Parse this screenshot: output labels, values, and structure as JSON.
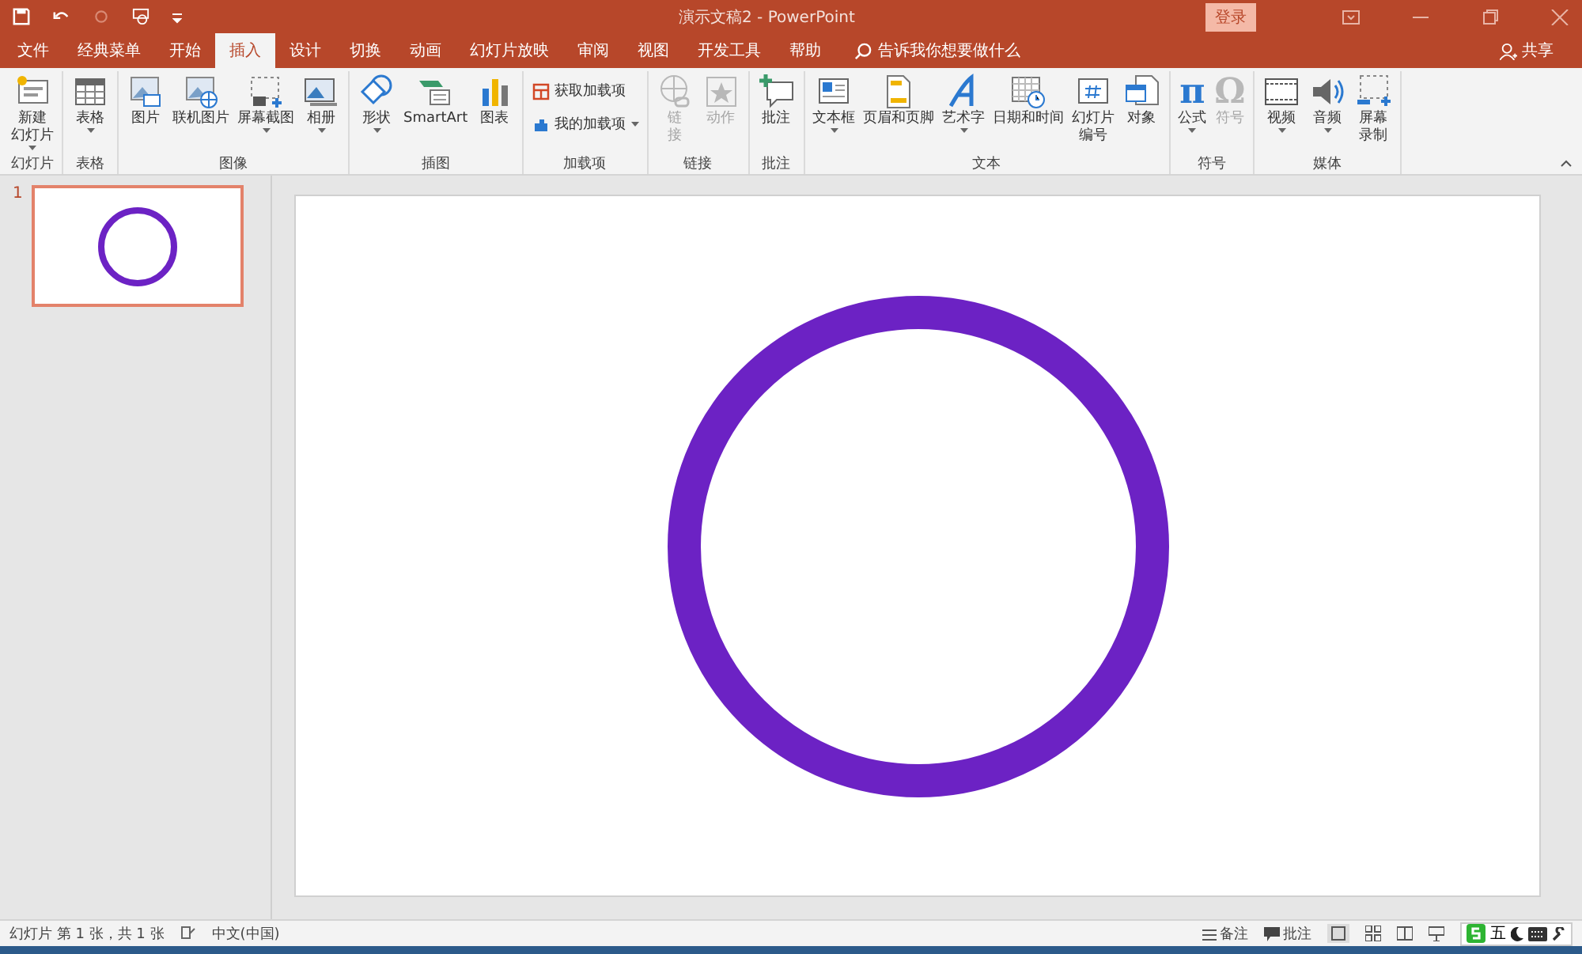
{
  "window": {
    "title": "演示文稿2  -  PowerPoint",
    "login": "登录"
  },
  "tabs": [
    {
      "label": "文件",
      "selected": false
    },
    {
      "label": "经典菜单",
      "selected": false
    },
    {
      "label": "开始",
      "selected": false
    },
    {
      "label": "插入",
      "selected": true
    },
    {
      "label": "设计",
      "selected": false
    },
    {
      "label": "切换",
      "selected": false
    },
    {
      "label": "动画",
      "selected": false
    },
    {
      "label": "幻灯片放映",
      "selected": false
    },
    {
      "label": "审阅",
      "selected": false
    },
    {
      "label": "视图",
      "selected": false
    },
    {
      "label": "开发工具",
      "selected": false
    },
    {
      "label": "帮助",
      "selected": false
    }
  ],
  "search": {
    "placeholder": "告诉我你想要做什么"
  },
  "share": "共享",
  "ribbon_groups": [
    {
      "label": "幻灯片",
      "kind": "large",
      "buttons": [
        {
          "kind": "slide",
          "label": [
            "新建",
            "幻灯片"
          ],
          "caret": true,
          "disabled": false
        }
      ]
    },
    {
      "label": "表格",
      "kind": "large",
      "buttons": [
        {
          "kind": "table",
          "label": [
            "表格"
          ],
          "caret": true,
          "disabled": false
        }
      ]
    },
    {
      "label": "图像",
      "kind": "large",
      "buttons": [
        {
          "kind": "picture",
          "label": [
            "图片"
          ],
          "caret": false,
          "disabled": false
        },
        {
          "kind": "online",
          "label": [
            "联机图片"
          ],
          "caret": false,
          "disabled": false
        },
        {
          "kind": "screenshot",
          "label": [
            "屏幕截图"
          ],
          "caret": true,
          "disabled": false
        },
        {
          "kind": "album",
          "label": [
            "相册"
          ],
          "caret": true,
          "disabled": false
        }
      ]
    },
    {
      "label": "插图",
      "kind": "large",
      "buttons": [
        {
          "kind": "shapes",
          "label": [
            "形状"
          ],
          "caret": true,
          "disabled": false
        },
        {
          "kind": "smartart",
          "label": [
            "SmartArt"
          ],
          "caret": false,
          "disabled": false
        },
        {
          "kind": "chart",
          "label": [
            "图表"
          ],
          "caret": false,
          "disabled": false
        }
      ]
    },
    {
      "label": "加载项",
      "kind": "small",
      "buttons": [
        {
          "kind": "store",
          "label": [
            "获取加载项"
          ],
          "caret": false,
          "disabled": false
        },
        {
          "kind": "addin",
          "label": [
            "我的加载项"
          ],
          "caret": true,
          "disabled": false
        }
      ]
    },
    {
      "label": "链接",
      "kind": "large",
      "buttons": [
        {
          "kind": "link",
          "label": [
            "链",
            "接"
          ],
          "caret": false,
          "disabled": true
        },
        {
          "kind": "action",
          "label": [
            "动作"
          ],
          "caret": false,
          "disabled": true
        }
      ]
    },
    {
      "label": "批注",
      "kind": "large",
      "buttons": [
        {
          "kind": "comment",
          "label": [
            "批注"
          ],
          "caret": false,
          "disabled": false
        }
      ]
    },
    {
      "label": "文本",
      "kind": "large",
      "buttons": [
        {
          "kind": "textbox",
          "label": [
            "文本框"
          ],
          "caret": true,
          "disabled": false
        },
        {
          "kind": "header",
          "label": [
            "页眉和页脚"
          ],
          "caret": false,
          "disabled": false
        },
        {
          "kind": "wordart",
          "label": [
            "艺术字"
          ],
          "caret": true,
          "disabled": false
        },
        {
          "kind": "datetime",
          "label": [
            "日期和时间"
          ],
          "caret": false,
          "disabled": false
        },
        {
          "kind": "slidenumber",
          "label": [
            "幻灯片",
            "编号"
          ],
          "caret": false,
          "disabled": false
        },
        {
          "kind": "object",
          "label": [
            "对象"
          ],
          "caret": false,
          "disabled": false
        }
      ]
    },
    {
      "label": "符号",
      "kind": "large",
      "buttons": [
        {
          "kind": "glyph",
          "glyph": "π",
          "label": [
            "公式"
          ],
          "caret": true,
          "disabled": false
        },
        {
          "kind": "glyph",
          "glyph": "Ω",
          "label": [
            "符号"
          ],
          "caret": false,
          "disabled": true
        }
      ]
    },
    {
      "label": "媒体",
      "kind": "large",
      "buttons": [
        {
          "kind": "video",
          "label": [
            "视频"
          ],
          "caret": true,
          "disabled": false
        },
        {
          "kind": "audio",
          "label": [
            "音频"
          ],
          "caret": true,
          "disabled": false
        },
        {
          "kind": "record",
          "label": [
            "屏幕",
            "录制"
          ],
          "caret": false,
          "disabled": false
        }
      ]
    }
  ],
  "thumbnails": [
    {
      "number": "1",
      "selected": true
    }
  ],
  "slide": {
    "shape": {
      "kind": "ring",
      "color": "#6c22c4"
    }
  },
  "status_bar": {
    "slide_info": "幻灯片 第 1 张，共 1 张",
    "language": "中文(中国)",
    "notes": "备注",
    "comments": "批注",
    "ime": "五"
  }
}
